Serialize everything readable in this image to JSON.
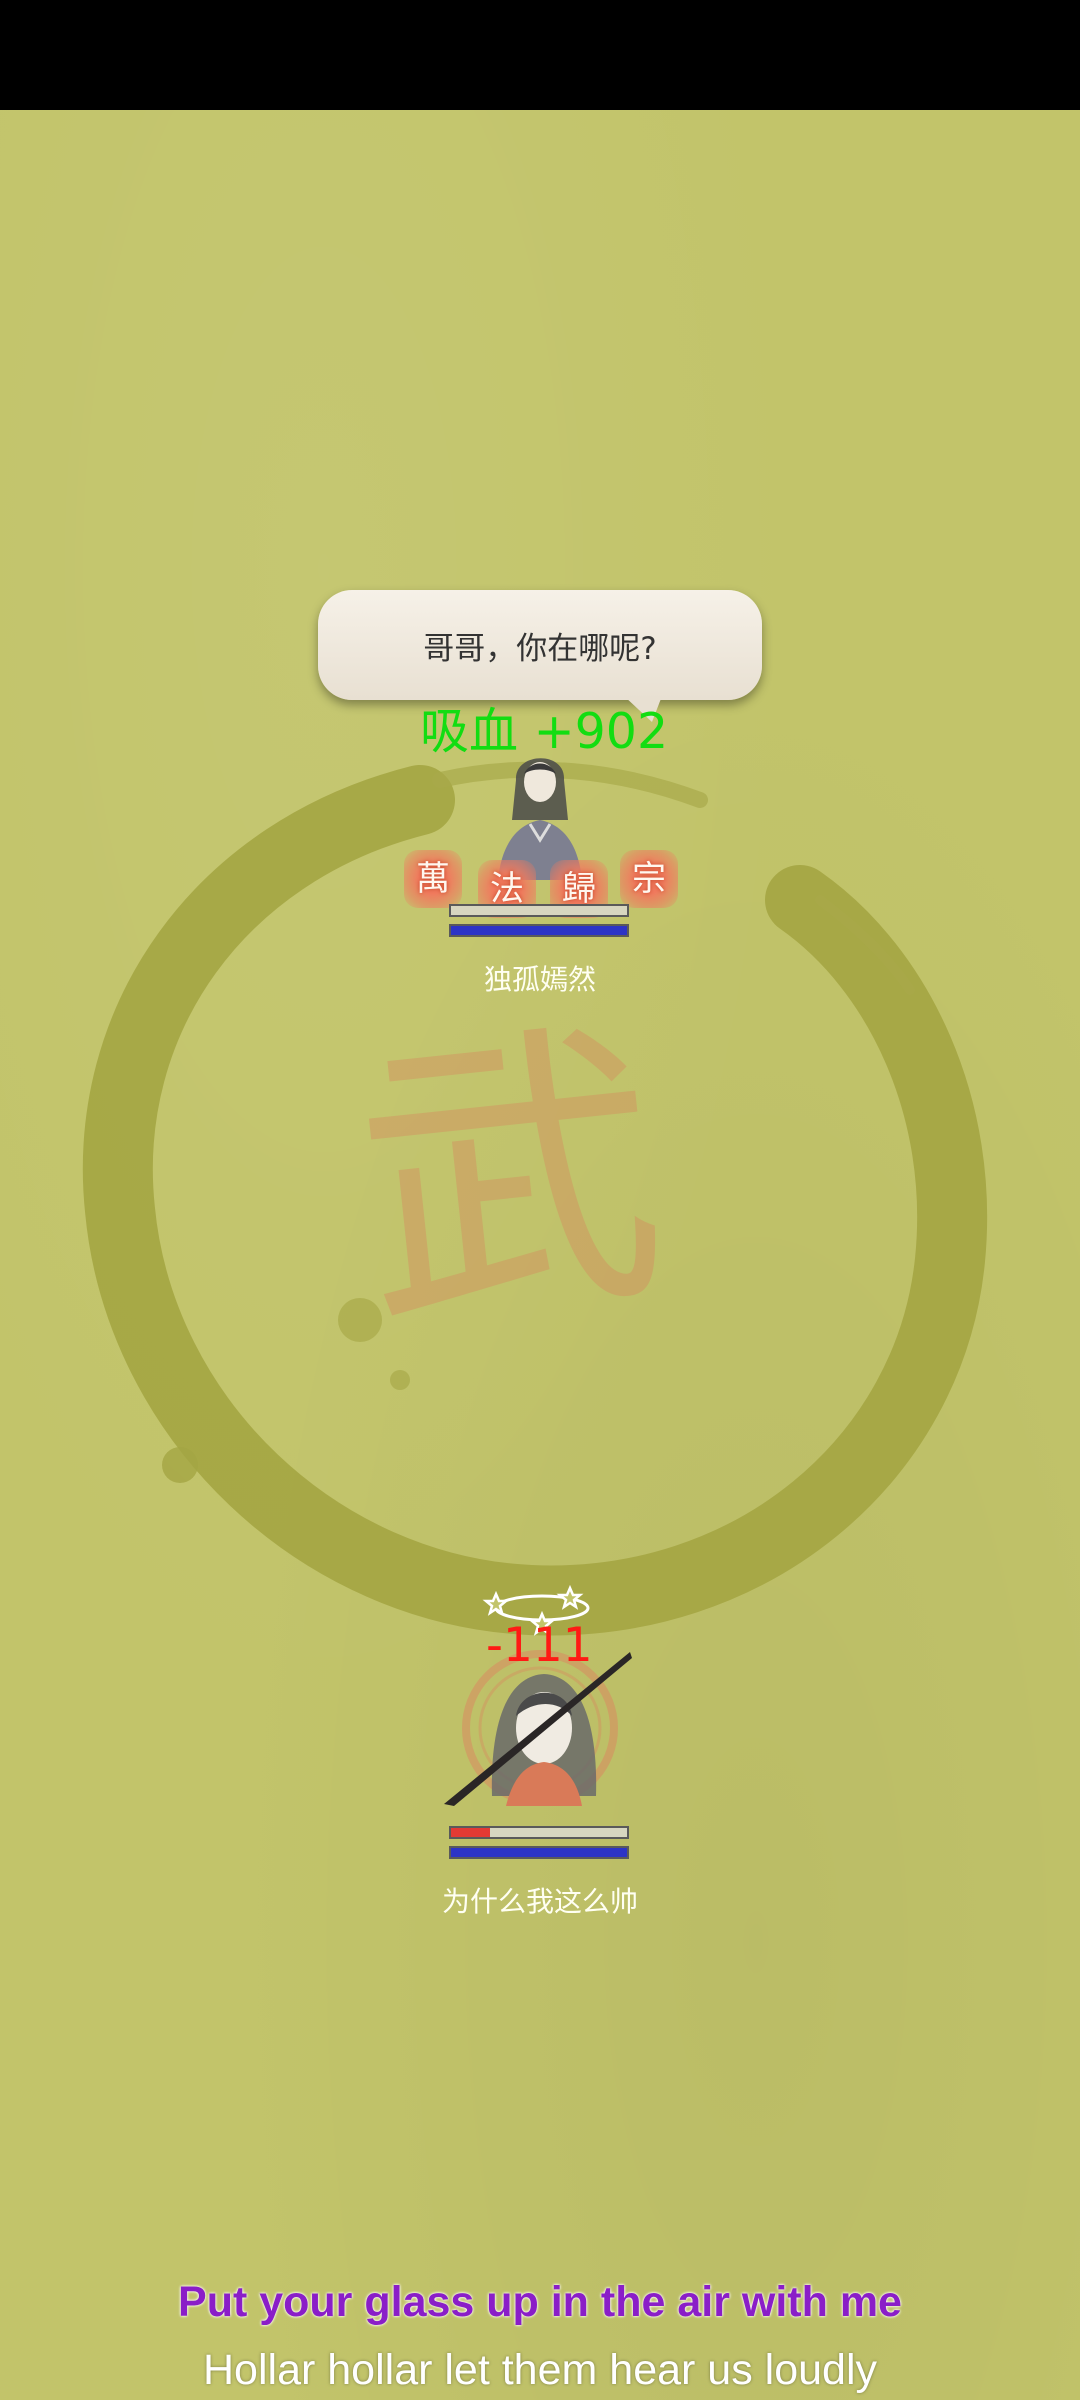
{
  "status_bar": {
    "color": "#000000"
  },
  "background": {
    "color": "#c2c46a",
    "watermark_glyph": "武",
    "watermark_color": "#dc785a"
  },
  "enemy": {
    "speech": "哥哥，你在哪呢?",
    "heal_text": "吸血 +902",
    "name": "独孤嫣然",
    "hp_fraction": 0.0,
    "mp_fraction": 1.0,
    "skill_seals": [
      "萬",
      "法",
      "歸",
      "宗"
    ],
    "portrait_icon": "woman-in-grey-robe-portrait"
  },
  "player": {
    "damage_text": "-111",
    "name": "为什么我这么帅",
    "hp_fraction": 0.22,
    "mp_fraction": 1.0,
    "status_icon": "dizzy-stars-icon",
    "portrait_icon": "long-haired-hero-portrait"
  },
  "lyrics": {
    "line1": "Put your glass up in the air with me",
    "line2": "Hollar hollar let them hear us loudly",
    "line1_color": "#8a1ec8",
    "line2_color": "#ffffff"
  }
}
